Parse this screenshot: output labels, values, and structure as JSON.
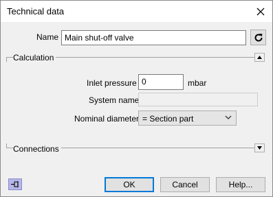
{
  "window": {
    "title": "Technical data"
  },
  "name_row": {
    "label": "Name",
    "value": "Main shut-off valve"
  },
  "calculation": {
    "header": "Calculation",
    "inlet_pressure_label": "Inlet pressure",
    "inlet_pressure_value": "0",
    "inlet_pressure_unit": "mbar",
    "system_name_label": "System name",
    "system_name_value": "",
    "nominal_diameter_label": "Nominal diameter",
    "nominal_diameter_value": "= Section part"
  },
  "connections": {
    "header": "Connections"
  },
  "buttons": {
    "ok": "OK",
    "cancel": "Cancel",
    "help": "Help..."
  },
  "icons": {
    "close": "close-icon",
    "refresh": "refresh-icon",
    "collapse": "collapse-up-icon",
    "expand": "expand-down-icon",
    "pin": "pin-icon",
    "dropdown": "chevron-down-icon"
  },
  "colors": {
    "focus_accent": "#0078d7",
    "pin_bg": "#b7b7e8"
  }
}
